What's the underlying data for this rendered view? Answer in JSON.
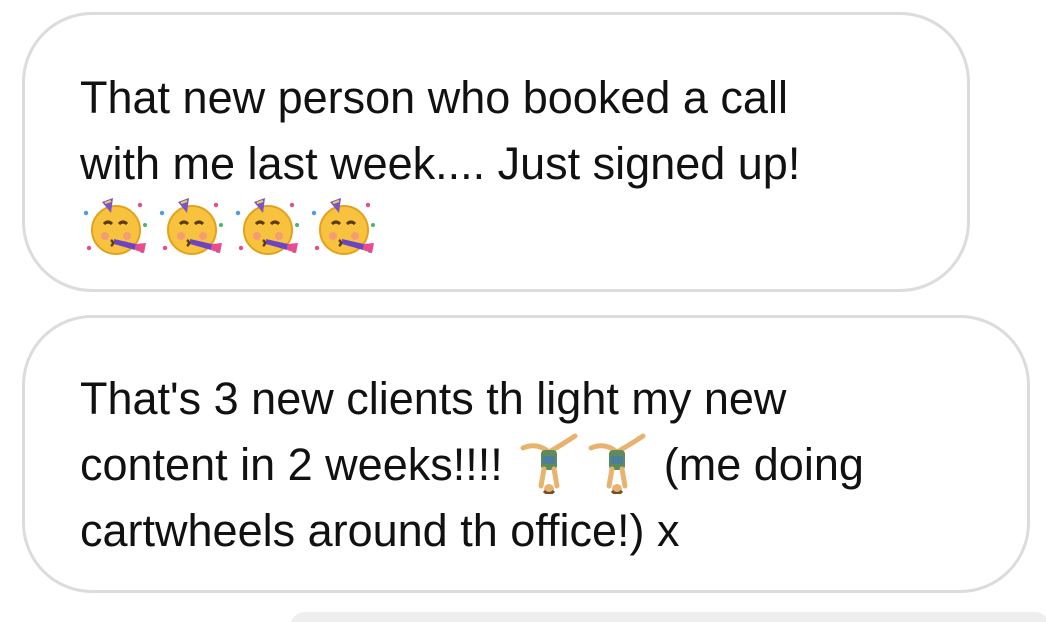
{
  "messages": [
    {
      "line1": "That new person who booked a call",
      "line2": "with me last week.... Just signed up!",
      "emojis": [
        "partying-face",
        "partying-face",
        "partying-face",
        "partying-face"
      ]
    },
    {
      "line1": "That's 3 new clients th light my new",
      "line2_before": "content in 2 weeks!!!!",
      "line2_after": "(me doing",
      "line3": "cartwheels around th office!) x",
      "emojis": [
        "cartwheel",
        "cartwheel"
      ]
    }
  ],
  "colors": {
    "bubble_border": "#dcdcdc",
    "bubble_background": "#ffffff",
    "text": "#111111",
    "next_bubble": "#eeeeee"
  }
}
